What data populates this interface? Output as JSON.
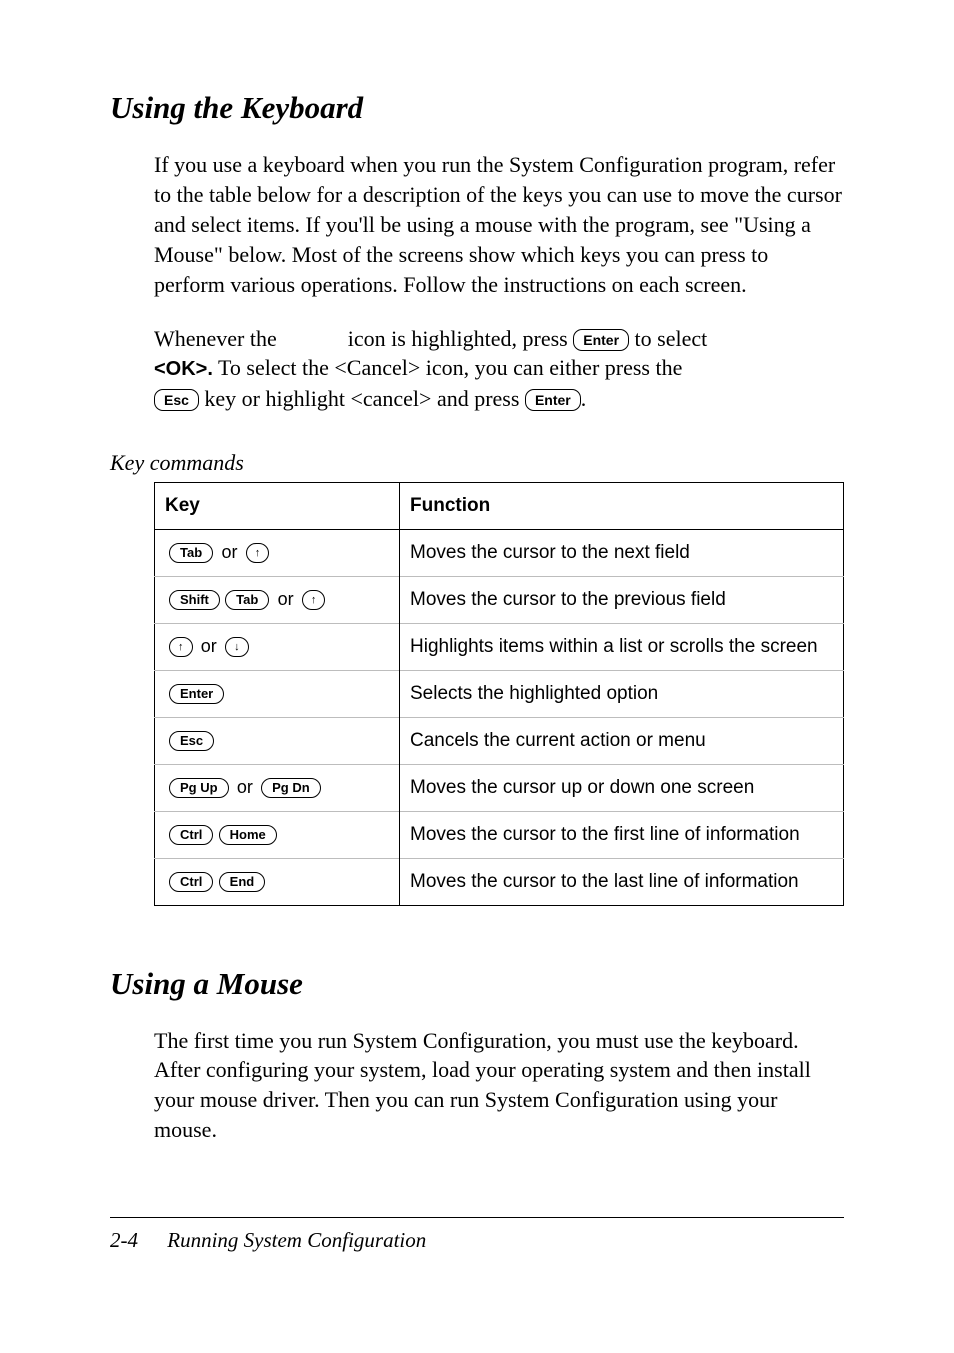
{
  "section1": {
    "title": "Using the Keyboard",
    "paragraph1": "If you use a keyboard when you run the System Configuration program, refer to the table below for a description of the keys you can use to move the cursor and select items. If you'll be using a mouse with the program, see \"Using a Mouse\" below. Most of the screens show which keys you can press to perform various operations. Follow the instructions on each screen.",
    "para2_pre": "Whenever the",
    "para2_mid": "icon is highlighted, press",
    "para2_after_enter": "to select",
    "para2_ok_label": "<OK>.",
    "para2_cancel_sentence": "To select the <Cancel> icon, you can either press the",
    "para2_tail1": "key or highlight <cancel> and press",
    "keys_inline": {
      "enter": "Enter",
      "esc": "Esc"
    },
    "table_caption": "Key commands",
    "table": {
      "headers": {
        "key": "Key",
        "func": "Function"
      },
      "rows": [
        {
          "keys": [
            [
              "Tab"
            ],
            "or",
            [
              "↑"
            ]
          ],
          "func": "Moves the cursor to the next field"
        },
        {
          "keys": [
            [
              "Shift"
            ],
            [
              "Tab"
            ],
            "or",
            [
              "↑"
            ]
          ],
          "func": "Moves the cursor to the previous field"
        },
        {
          "keys": [
            [
              "↑"
            ],
            "or",
            [
              "↓"
            ]
          ],
          "func": "Highlights items within a list or scrolls the screen"
        },
        {
          "keys": [
            [
              "Enter"
            ]
          ],
          "func": "Selects the highlighted option"
        },
        {
          "keys": [
            [
              "Esc"
            ]
          ],
          "func": "Cancels the current action or menu"
        },
        {
          "keys": [
            [
              "Pg Up"
            ],
            "or",
            [
              "Pg Dn"
            ]
          ],
          "func": "Moves the cursor up or down one screen"
        },
        {
          "keys": [
            [
              "Ctrl"
            ],
            [
              "Home"
            ]
          ],
          "func": "Moves the cursor to the first line of information"
        },
        {
          "keys": [
            [
              "Ctrl"
            ],
            [
              "End"
            ]
          ],
          "func": "Moves the cursor to the last line of information"
        }
      ]
    }
  },
  "section2": {
    "title": "Using a Mouse",
    "paragraph": "The first time you run System Configuration, you must use the keyboard. After configuring your system, load your operating system and then install your mouse driver. Then you can run System Configuration using your mouse."
  },
  "footer": {
    "page": "2-4",
    "title": "Running System Configuration"
  }
}
